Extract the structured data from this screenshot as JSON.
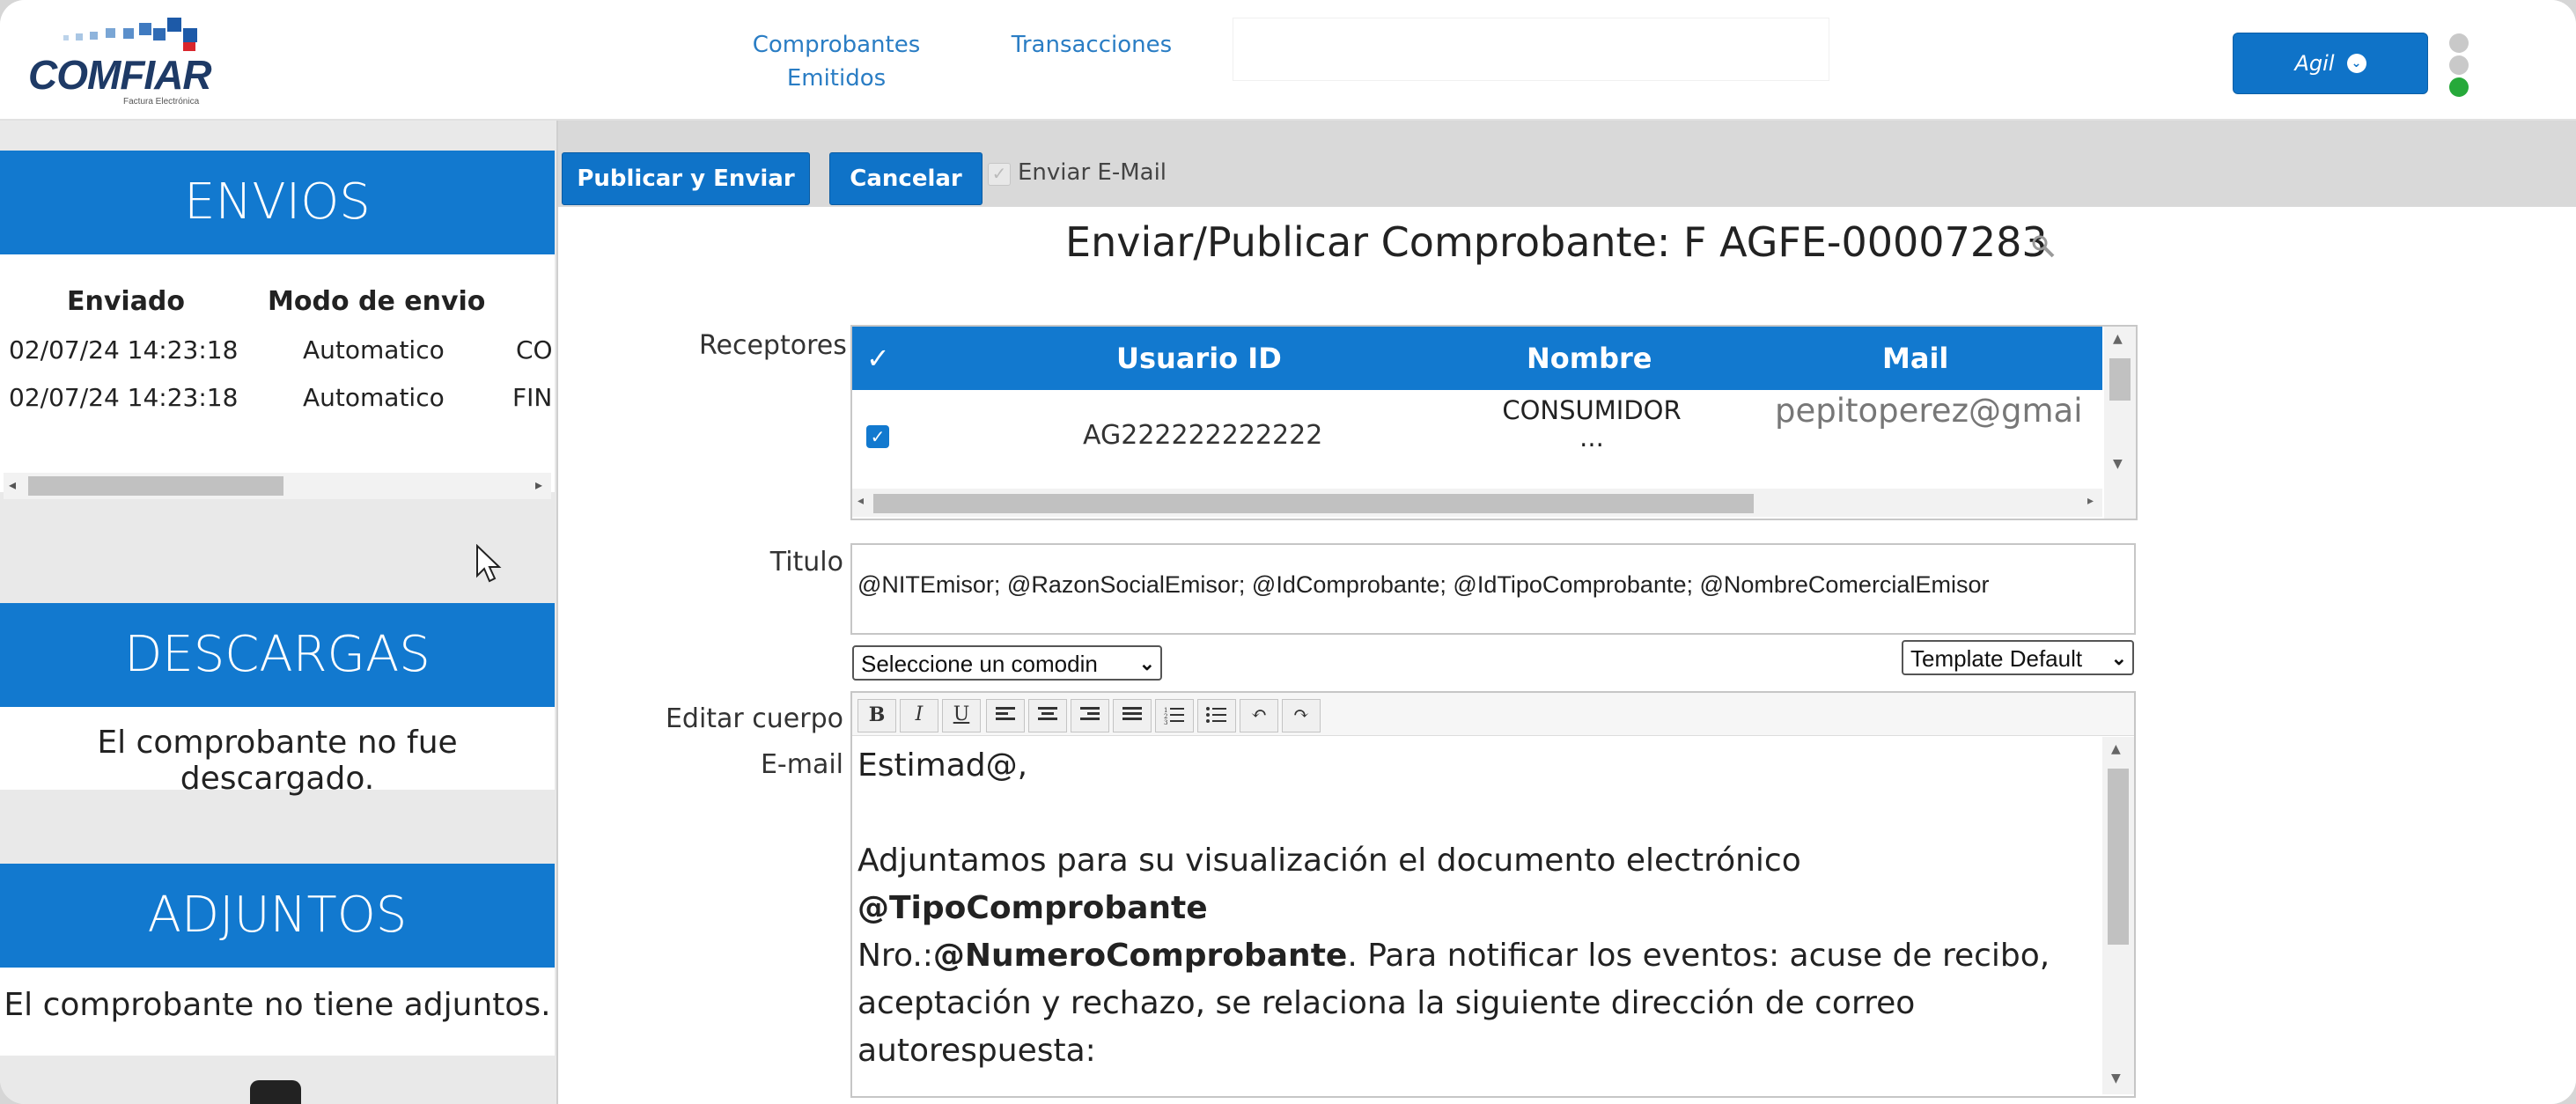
{
  "header": {
    "logo_text": "COMFIAR",
    "logo_subtext": "Factura Electrónica",
    "nav": [
      {
        "label_line1": "Comprobantes",
        "label_line2": "Emitidos"
      },
      {
        "label_line1": "Transacciones"
      }
    ],
    "user_button": "Agil",
    "colors": {
      "brand_blue": "#1279cf",
      "status_green": "#26a93a"
    }
  },
  "sidebar": {
    "envios": {
      "title": "ENVIOS",
      "columns": [
        "Enviado",
        "Modo de envio"
      ],
      "rows": [
        {
          "enviado": "02/07/24 14:23:18",
          "modo": "Automatico",
          "extra": "CO"
        },
        {
          "enviado": "02/07/24 14:23:18",
          "modo": "Automatico",
          "extra": "FIN"
        }
      ]
    },
    "descargas": {
      "title": "DESCARGAS",
      "message": "El comprobante no fue descargado."
    },
    "adjuntos": {
      "title": "ADJUNTOS",
      "message": "El comprobante no tiene adjuntos."
    }
  },
  "toolbar": {
    "publicar_label": "Publicar y Enviar",
    "cancelar_label": "Cancelar",
    "enviar_email_label": "Enviar E-Mail"
  },
  "main": {
    "page_title": "Enviar/Publicar Comprobante: F AGFE-00007283",
    "receptores_label": "Receptores",
    "receptores_table": {
      "check_header": "✓",
      "columns": [
        "Usuario ID",
        "Nombre",
        "Mail"
      ],
      "rows": [
        {
          "usuario_id": "AG222222222222",
          "nombre_line1": "CONSUMIDOR",
          "nombre_line2": "...",
          "mail": "pepitoperez@gmai"
        }
      ]
    },
    "titulo_label": "Titulo",
    "titulo_value": "@NITEmisor; @RazonSocialEmisor; @IdComprobante; @IdTipoComprobante; @NombreComercialEmisor",
    "comodin_select": "Seleccione un comodin",
    "template_select": "Template Default",
    "editar_label_line1": "Editar cuerpo",
    "editar_label_line2": "E-mail",
    "editor_toolbar": [
      "B",
      "I",
      "U"
    ],
    "body": {
      "greeting": "Estimad@,",
      "p1_a": "Adjuntamos para su visualización el documento electrónico ",
      "p1_b": "@TipoComprobante",
      "p2_a": "Nro.:",
      "p2_b": "@NumeroComprobante",
      "p2_c": ". Para notificar los eventos: acuse de recibo,",
      "p3": "aceptación y rechazo, se relaciona la siguiente dirección de correo autorespuesta:"
    }
  }
}
